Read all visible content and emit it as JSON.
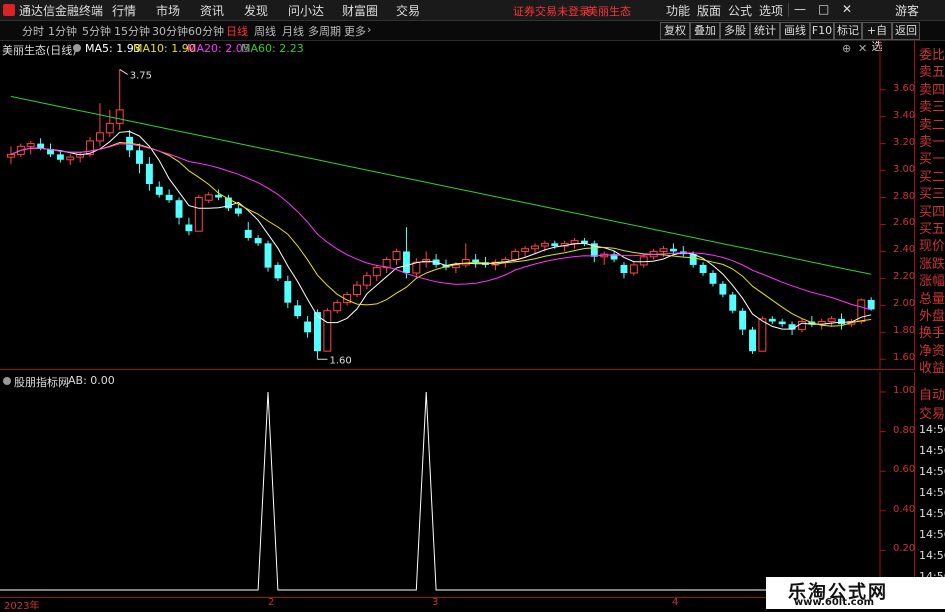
{
  "app": {
    "title": "通达信金融终端",
    "status_warning": "证券交易未登录",
    "stock_name": "美丽生态"
  },
  "menu": {
    "items": [
      "行情",
      "市场",
      "资讯",
      "发现",
      "问小达",
      "财富圈",
      "交易"
    ],
    "right": [
      "功能",
      "版面",
      "公式",
      "选项"
    ],
    "user": "游客"
  },
  "periods": {
    "items": [
      "分时",
      "1分钟",
      "5分钟",
      "15分钟",
      "30分钟",
      "60分钟",
      "日线",
      "周线",
      "月线",
      "多周期",
      "更多"
    ],
    "active": "日线"
  },
  "toolbar_right": [
    "复权",
    "叠加",
    "多股",
    "统计",
    "画线",
    "F10",
    "标记",
    "+自选",
    "返回"
  ],
  "main_chart": {
    "title": "美丽生态(日线)",
    "ma": [
      {
        "label": "MA5: 1.93",
        "color": "#ffffff"
      },
      {
        "label": "MA10: 1.90",
        "color": "#e6e600"
      },
      {
        "label": "MA20: 2.05",
        "color": "#ff33ff"
      },
      {
        "label": "MA60: 2.23",
        "color": "#33cc33"
      }
    ],
    "high_label": "3.75",
    "low_label": "1.60",
    "y_ticks": [
      "3.60",
      "3.40",
      "3.20",
      "3.00",
      "2.80",
      "2.60",
      "2.40",
      "2.20",
      "2.00",
      "1.80",
      "1.60"
    ]
  },
  "indicator": {
    "title": "股朋指标网",
    "value_label": "AB: 0.00",
    "y_ticks": [
      "1.00",
      "0.80",
      "0.60",
      "0.40",
      "0.20"
    ]
  },
  "x_axis": {
    "labels": [
      "2023年",
      "2",
      "3",
      "4"
    ]
  },
  "side_panel": {
    "labels": [
      "委比",
      "卖五",
      "卖四",
      "卖三",
      "卖二",
      "卖一",
      "买一",
      "买二",
      "买三",
      "买四",
      "买五",
      "现价",
      "涨跌",
      "涨幅",
      "总量",
      "外盘",
      "换手",
      "净资",
      "收益"
    ],
    "bottom_labels": [
      "自动",
      "交易"
    ],
    "times": [
      "14:56",
      "14:56",
      "14:56",
      "14:56",
      "14:56",
      "14:56",
      "14:56",
      "14:56"
    ]
  },
  "window_controls": {
    "min": "—",
    "max": "□",
    "close": "✕"
  },
  "watermark": {
    "text": "乐淘公式网",
    "url": "www.60lt.com"
  },
  "chart_data": [
    {
      "type": "candlestick",
      "title": "美丽生态(日线)",
      "ylim": [
        1.55,
        3.85
      ],
      "y_ticks": [
        1.6,
        1.8,
        2.0,
        2.2,
        2.4,
        2.6,
        2.8,
        3.0,
        3.2,
        3.4,
        3.6
      ],
      "candles_ohlc": [
        [
          3.1,
          3.18,
          3.05,
          3.12
        ],
        [
          3.12,
          3.2,
          3.1,
          3.18
        ],
        [
          3.18,
          3.22,
          3.12,
          3.2
        ],
        [
          3.2,
          3.24,
          3.15,
          3.16
        ],
        [
          3.16,
          3.2,
          3.1,
          3.12
        ],
        [
          3.12,
          3.15,
          3.06,
          3.08
        ],
        [
          3.08,
          3.12,
          3.04,
          3.1
        ],
        [
          3.1,
          3.14,
          3.06,
          3.12
        ],
        [
          3.12,
          3.25,
          3.1,
          3.22
        ],
        [
          3.22,
          3.5,
          3.18,
          3.28
        ],
        [
          3.28,
          3.45,
          3.25,
          3.35
        ],
        [
          3.35,
          3.75,
          3.3,
          3.45
        ],
        [
          3.25,
          3.3,
          3.1,
          3.15
        ],
        [
          3.15,
          3.2,
          2.98,
          3.05
        ],
        [
          3.05,
          3.1,
          2.85,
          2.9
        ],
        [
          2.88,
          2.92,
          2.8,
          2.82
        ],
        [
          2.82,
          2.86,
          2.76,
          2.78
        ],
        [
          2.78,
          2.8,
          2.6,
          2.65
        ],
        [
          2.6,
          2.65,
          2.52,
          2.55
        ],
        [
          2.55,
          2.82,
          2.55,
          2.8
        ],
        [
          2.78,
          2.84,
          2.76,
          2.82
        ],
        [
          2.82,
          2.86,
          2.78,
          2.8
        ],
        [
          2.8,
          2.82,
          2.7,
          2.72
        ],
        [
          2.72,
          2.75,
          2.66,
          2.68
        ],
        [
          2.56,
          2.62,
          2.48,
          2.5
        ],
        [
          2.5,
          2.52,
          2.44,
          2.46
        ],
        [
          2.46,
          2.48,
          2.25,
          2.28
        ],
        [
          2.3,
          2.32,
          2.18,
          2.2
        ],
        [
          2.18,
          2.22,
          1.98,
          2.02
        ],
        [
          2.0,
          2.04,
          1.9,
          1.92
        ],
        [
          1.88,
          1.92,
          1.76,
          1.8
        ],
        [
          1.95,
          1.97,
          1.6,
          1.66
        ],
        [
          1.66,
          1.98,
          1.66,
          1.96
        ],
        [
          1.96,
          2.04,
          1.94,
          2.02
        ],
        [
          2.02,
          2.1,
          2.0,
          2.08
        ],
        [
          2.08,
          2.18,
          2.06,
          2.15
        ],
        [
          2.15,
          2.25,
          2.12,
          2.22
        ],
        [
          2.22,
          2.3,
          2.18,
          2.28
        ],
        [
          2.28,
          2.36,
          2.24,
          2.34
        ],
        [
          2.34,
          2.42,
          2.3,
          2.4
        ],
        [
          2.4,
          2.58,
          2.2,
          2.24
        ],
        [
          2.24,
          2.35,
          2.2,
          2.32
        ],
        [
          2.32,
          2.4,
          2.28,
          2.34
        ],
        [
          2.34,
          2.38,
          2.28,
          2.3
        ],
        [
          2.3,
          2.34,
          2.26,
          2.28
        ],
        [
          2.28,
          2.32,
          2.24,
          2.3
        ],
        [
          2.3,
          2.46,
          2.28,
          2.34
        ],
        [
          2.34,
          2.38,
          2.28,
          2.32
        ],
        [
          2.32,
          2.36,
          2.28,
          2.3
        ],
        [
          2.3,
          2.34,
          2.26,
          2.32
        ],
        [
          2.32,
          2.36,
          2.28,
          2.34
        ],
        [
          2.34,
          2.42,
          2.32,
          2.4
        ],
        [
          2.4,
          2.44,
          2.36,
          2.42
        ],
        [
          2.42,
          2.46,
          2.38,
          2.44
        ],
        [
          2.44,
          2.48,
          2.4,
          2.46
        ],
        [
          2.46,
          2.48,
          2.42,
          2.44
        ],
        [
          2.44,
          2.48,
          2.4,
          2.46
        ],
        [
          2.46,
          2.5,
          2.42,
          2.48
        ],
        [
          2.48,
          2.5,
          2.44,
          2.46
        ],
        [
          2.46,
          2.48,
          2.32,
          2.36
        ],
        [
          2.36,
          2.4,
          2.3,
          2.38
        ],
        [
          2.38,
          2.4,
          2.32,
          2.34
        ],
        [
          2.3,
          2.32,
          2.2,
          2.24
        ],
        [
          2.24,
          2.32,
          2.22,
          2.3
        ],
        [
          2.3,
          2.38,
          2.28,
          2.36
        ],
        [
          2.36,
          2.42,
          2.34,
          2.4
        ],
        [
          2.4,
          2.44,
          2.36,
          2.42
        ],
        [
          2.42,
          2.46,
          2.38,
          2.4
        ],
        [
          2.4,
          2.44,
          2.36,
          2.38
        ],
        [
          2.38,
          2.4,
          2.28,
          2.3
        ],
        [
          2.3,
          2.32,
          2.22,
          2.24
        ],
        [
          2.24,
          2.26,
          2.14,
          2.16
        ],
        [
          2.16,
          2.18,
          2.06,
          2.08
        ],
        [
          2.08,
          2.1,
          1.94,
          1.96
        ],
        [
          1.96,
          1.98,
          1.78,
          1.82
        ],
        [
          1.82,
          1.84,
          1.64,
          1.66
        ],
        [
          1.66,
          1.92,
          1.66,
          1.9
        ],
        [
          1.9,
          1.92,
          1.86,
          1.88
        ],
        [
          1.88,
          1.9,
          1.84,
          1.86
        ],
        [
          1.86,
          1.88,
          1.78,
          1.82
        ],
        [
          1.82,
          1.9,
          1.8,
          1.88
        ],
        [
          1.88,
          1.92,
          1.84,
          1.86
        ],
        [
          1.86,
          1.9,
          1.82,
          1.88
        ],
        [
          1.88,
          1.92,
          1.84,
          1.9
        ],
        [
          1.9,
          1.94,
          1.82,
          1.86
        ],
        [
          1.86,
          1.9,
          1.84,
          1.88
        ],
        [
          1.88,
          2.05,
          1.86,
          2.04
        ],
        [
          2.04,
          2.06,
          1.96,
          1.97
        ]
      ],
      "series": [
        {
          "name": "MA5",
          "color": "#ffffff"
        },
        {
          "name": "MA10",
          "color": "#e6e600"
        },
        {
          "name": "MA20",
          "color": "#ff33ff"
        },
        {
          "name": "MA60",
          "color": "#33cc33"
        }
      ]
    },
    {
      "type": "line",
      "title": "股朋指标网",
      "ylim": [
        0,
        1.0
      ],
      "series": [
        {
          "name": "AB",
          "values_spikes_at": [
            26,
            42
          ]
        }
      ]
    }
  ]
}
